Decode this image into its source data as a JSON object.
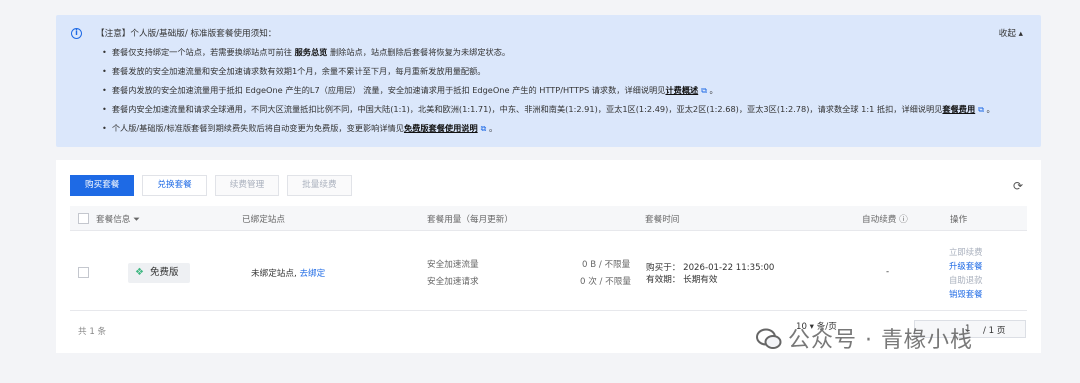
{
  "notice": {
    "title": "【注意】个人版/基础版/ 标准版套餐使用须知：",
    "collapse": "收起 ▴",
    "items": [
      {
        "pre": "套餐仅支持绑定一个站点，若需要换绑站点可前往 ",
        "bold": "服务总览",
        "post": " 删除站点，站点删除后套餐将恢复为未绑定状态。"
      },
      {
        "pre": "套餐发放的安全加速流量和安全加速请求数有效期1个月，余量不累计至下月，每月重新发放用量配额。"
      },
      {
        "pre": "套餐内发放的安全加速流量用于抵扣 EdgeOne 产生的L7（应用层） 流量，安全加速请求用于抵扣 EdgeOne 产生的 HTTP/HTTPS 请求数，详细说明见",
        "link": "计费概述"
      },
      {
        "pre": "套餐内安全加速流量和请求全球通用，不同大区流量抵扣比例不同，中国大陆(1:1)，北美和欧洲(1:1.71)，中东、非洲和南美(1:2.91)，亚太1区(1:2.49)，亚太2区(1:2.68)，亚太3区(1:2.78)，请求数全球 1:1 抵扣，详细说明见",
        "link": "套餐费用"
      },
      {
        "pre": "个人版/基础版/标准版套餐到期续费失败后将自动变更为免费版，变更影响详情见",
        "link": "免费版套餐使用说明"
      }
    ]
  },
  "toolbar": {
    "buy": "购买套餐",
    "redeem": "兑换套餐",
    "renew_manage": "续费管理",
    "batch_renew": "批量续费"
  },
  "table": {
    "headers": {
      "plan_info": "套餐信息",
      "bound_site": "已绑定站点",
      "usage": "套餐用量（每月更新）",
      "plan_time": "套餐时间",
      "auto_renew": "自动续费",
      "actions": "操作"
    },
    "row": {
      "plan_badge": "免费版",
      "site_text": "未绑定站点,",
      "site_link": "去绑定",
      "usage_traffic_label": "安全加速流量",
      "usage_traffic_value": "0 B / 不限量",
      "usage_request_label": "安全加速请求",
      "usage_request_value": "0 次 / 不限量",
      "purchase_time": "购买于： 2026-01-22 11:35:00",
      "validity": "有效期： 长期有效",
      "auto_renew": "-",
      "ops": {
        "renew_now": "立即续费",
        "upgrade": "升级套餐",
        "auto_return": "自助退款",
        "destroy": "销毁套餐"
      }
    }
  },
  "footer": {
    "total": "共 1 条",
    "page_size": "10 ▾ 条/页",
    "page_current": "1",
    "page_total": "/ 1 页"
  },
  "watermark": "公众号 · 青椽小栈"
}
